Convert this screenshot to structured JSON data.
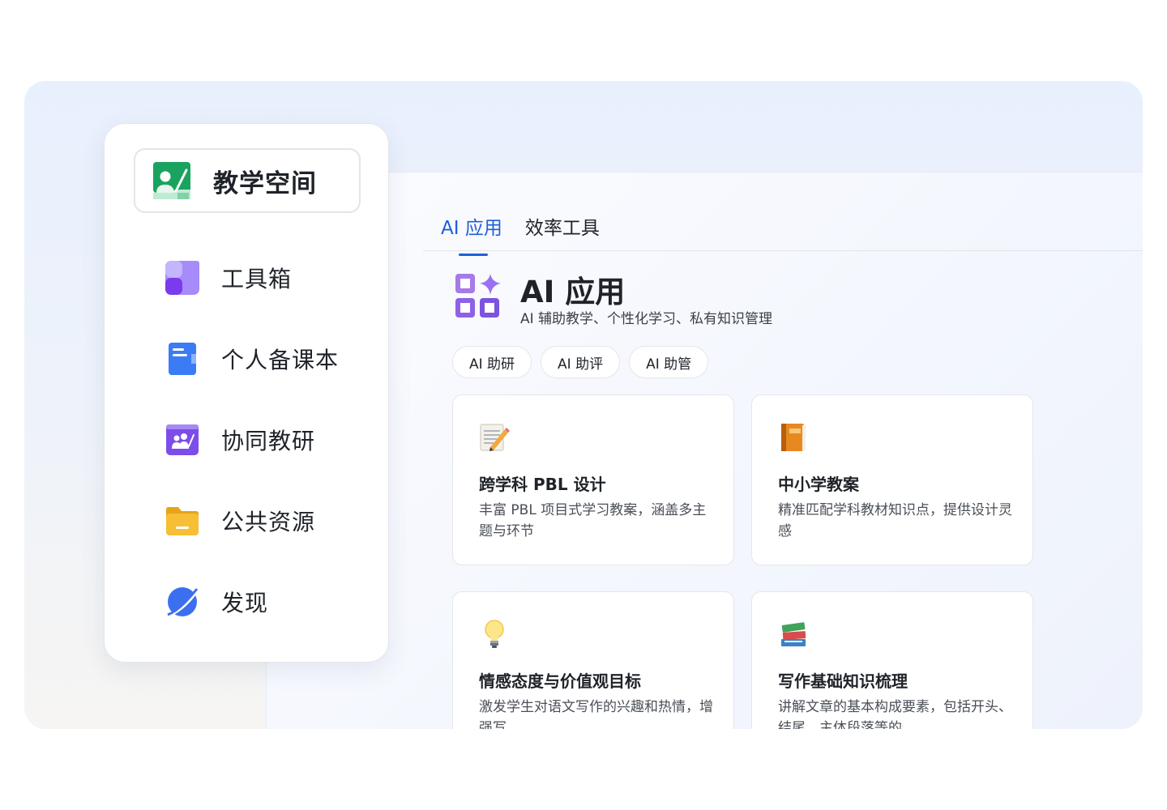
{
  "sidebar": {
    "workspace_label": "教学空间",
    "items": [
      {
        "label": "工具箱",
        "icon": "toolbox-icon"
      },
      {
        "label": "个人备课本",
        "icon": "notebook-icon"
      },
      {
        "label": "协同教研",
        "icon": "collaboration-icon"
      },
      {
        "label": "公共资源",
        "icon": "folder-icon"
      },
      {
        "label": "发现",
        "icon": "planet-icon"
      }
    ]
  },
  "tabs": [
    {
      "label": "AI 应用",
      "active": true
    },
    {
      "label": "效率工具",
      "active": false
    }
  ],
  "header": {
    "title": "AI 应用",
    "subtitle": "AI 辅助教学、个性化学习、私有知识管理"
  },
  "chips": [
    "AI 助研",
    "AI 助评",
    "AI 助管"
  ],
  "cards": [
    {
      "title": "跨学科 PBL 设计",
      "desc": "丰富 PBL 项目式学习教案，涵盖多主题与环节",
      "icon": "memo-pencil-icon"
    },
    {
      "title": "中小学教案",
      "desc": "精准匹配学科教材知识点，提供设计灵感",
      "icon": "orange-book-icon"
    },
    {
      "title": "情感态度与价值观目标",
      "desc": "激发学生对语文写作的兴趣和热情，增强写",
      "icon": "lightbulb-icon"
    },
    {
      "title": "写作基础知识梳理",
      "desc": "讲解文章的基本构成要素，包括开头、结尾、主体段落等的",
      "icon": "books-icon"
    }
  ],
  "colors": {
    "accent": "#1e5fd6",
    "workspace_green": "#1aa35e",
    "toolbox_purple": "#8b5cf6",
    "notebook_blue": "#3b7cf6",
    "collab_purple": "#7c4dea",
    "folder_yellow": "#f5b82e",
    "planet_blue": "#3c6ff0"
  }
}
